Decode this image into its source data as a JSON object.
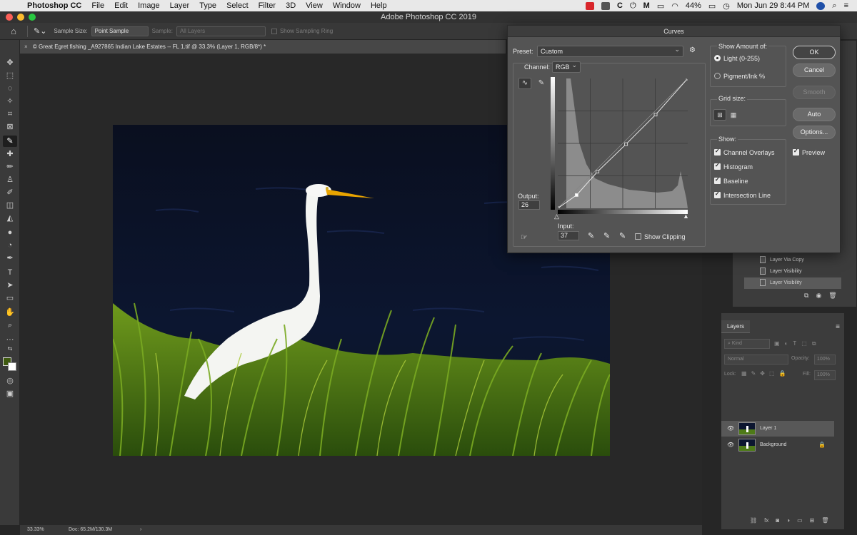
{
  "menubar": {
    "app_name": "Photoshop CC",
    "items": [
      "File",
      "Edit",
      "Image",
      "Layer",
      "Type",
      "Select",
      "Filter",
      "3D",
      "View",
      "Window",
      "Help"
    ],
    "battery": "44%",
    "clock": "Mon Jun 29  8:44 PM"
  },
  "window": {
    "title": "Adobe Photoshop CC 2019"
  },
  "options_bar": {
    "sample_size_label": "Sample Size:",
    "sample_size_value": "Point Sample",
    "sample_label": "Sample:",
    "sample_value": "All Layers",
    "show_sampling_ring_label": "Show Sampling Ring"
  },
  "document": {
    "tab_title": "© Great Egret fishing _A927865 Indian Lake Estates -- FL 1.tif @ 33.3% (Layer 1, RGB/8*) *",
    "zoom": "33.33%",
    "doc_size": "Doc: 65.2M/130.3M"
  },
  "colors": {
    "foreground": "#3f5a10",
    "background": "#ffffff"
  },
  "history": {
    "items": [
      {
        "label": "Layer Via Copy",
        "selected": false
      },
      {
        "label": "Layer Visibility",
        "selected": false
      },
      {
        "label": "Layer Visibility",
        "selected": true
      }
    ]
  },
  "layers": {
    "tab_label": "Layers",
    "kind_filter": "Kind",
    "blend_mode": "Normal",
    "opacity_label": "Opacity:",
    "opacity_value": "100%",
    "lock_label": "Lock:",
    "fill_label": "Fill:",
    "fill_value": "100%",
    "items": [
      {
        "name": "Layer 1",
        "visible": true,
        "selected": true,
        "locked": false
      },
      {
        "name": "Background",
        "visible": true,
        "selected": false,
        "locked": true
      }
    ]
  },
  "curves": {
    "title": "Curves",
    "preset_label": "Preset:",
    "preset_value": "Custom",
    "channel_label": "Channel:",
    "channel_value": "RGB",
    "output_label": "Output:",
    "output_value": "26",
    "input_label": "Input:",
    "input_value": "37",
    "show_clipping_label": "Show Clipping",
    "show_amount_label": "Show Amount of:",
    "light_label": "Light  (0-255)",
    "pigment_label": "Pigment/Ink %",
    "grid_size_label": "Grid size:",
    "show_label": "Show:",
    "checks": {
      "channel_overlays": "Channel Overlays",
      "histogram": "Histogram",
      "baseline": "Baseline",
      "intersection_line": "Intersection Line"
    },
    "buttons": {
      "ok": "OK",
      "cancel": "Cancel",
      "smooth": "Smooth",
      "auto": "Auto",
      "options": "Options..."
    },
    "preview_label": "Preview",
    "curve_points": [
      [
        0,
        0
      ],
      [
        37,
        26
      ],
      [
        78,
        72
      ],
      [
        134,
        126
      ],
      [
        192,
        184
      ],
      [
        255,
        255
      ]
    ]
  }
}
